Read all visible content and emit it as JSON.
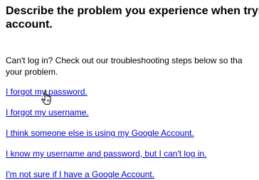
{
  "heading": {
    "line1": "Describe the problem you experience when tryi",
    "line2": "account."
  },
  "intro": {
    "line1": "Can't log in? Check out our troubleshooting steps below so tha",
    "line2": "your problem."
  },
  "options": [
    {
      "label": "I forgot my password."
    },
    {
      "label": "I forgot my username."
    },
    {
      "label": "I think someone else is using my Google Account."
    },
    {
      "label": "I know my username and password, but I can't log in."
    },
    {
      "label": "I'm not sure if I have a Google Account."
    }
  ],
  "colors": {
    "link": "#0000cc",
    "text": "#000000",
    "background": "#ffffff"
  },
  "cursor": {
    "icon": "hand-pointer-icon"
  }
}
